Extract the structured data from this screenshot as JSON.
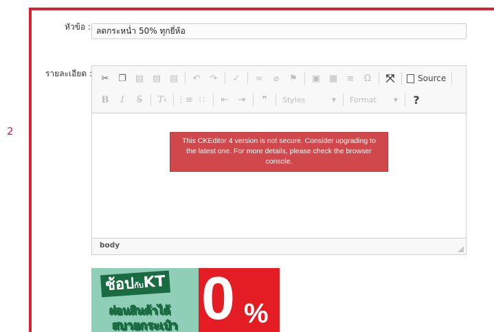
{
  "step": {
    "number": "2"
  },
  "form": {
    "title_label": "หัวข้อ :",
    "title_value": "ลดกระหน่ำ 50% ทุกยี่ห้อ",
    "detail_label": "รายละเอียด :"
  },
  "editor": {
    "toolbar": {
      "source_label": "Source",
      "styles_label": "Styles",
      "format_label": "Format"
    },
    "security_notice": "This CKEditor 4 version is not secure. Consider upgrading to the latest one. For more details, please check the browser console.",
    "path": "body"
  },
  "banner": {
    "line1": "ช้อป",
    "line1_small": "กับ",
    "line1_brand": "KT",
    "line2": "ผ่อนสินค้าได้",
    "line3": "สบายกระเป๋า",
    "zero": "0",
    "percent": "%"
  },
  "colors": {
    "accent_red": "#d9202f",
    "notice_bg": "#d0484b",
    "banner_green": "#1b6b42",
    "banner_mint": "#8fcfb8"
  }
}
